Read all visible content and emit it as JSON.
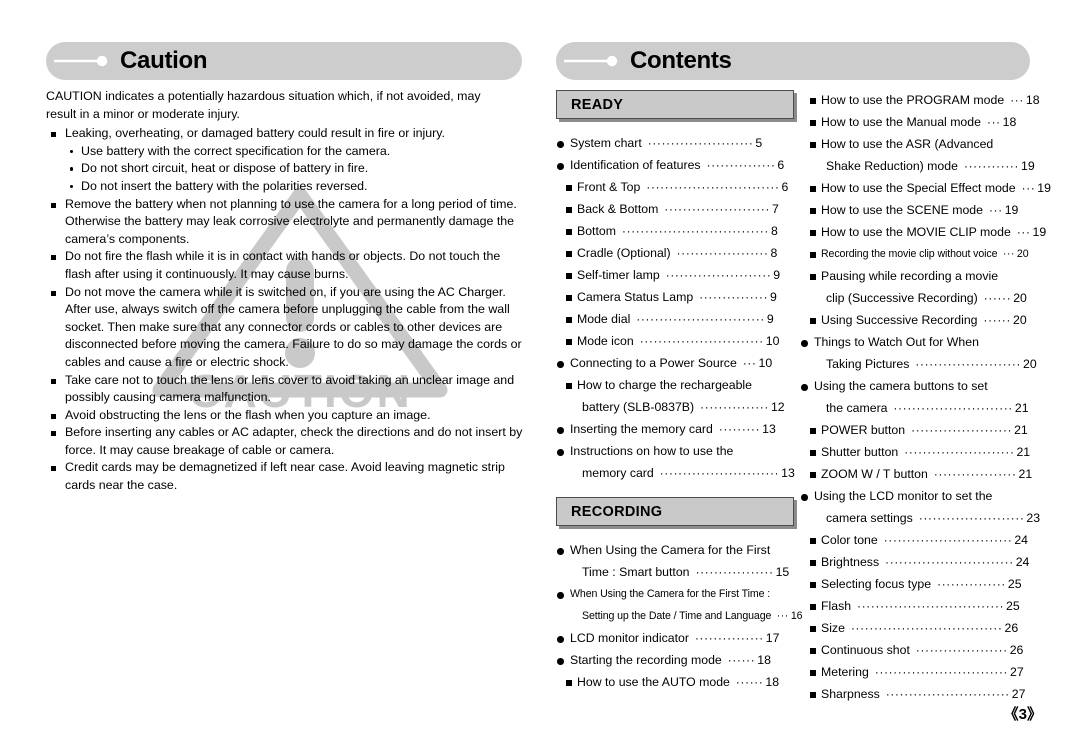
{
  "page": {
    "number_label": "《3》"
  },
  "caution": {
    "header_title": "Caution",
    "header_icon": "line-dot-icon",
    "intro": "CAUTION indicates a potentially hazardous situation which, if not avoided, may result in a minor or moderate injury.",
    "items": [
      {
        "text": "Leaking, overheating, or damaged battery could result in fire or injury.",
        "subitems": [
          "Use battery with the correct specification for the camera.",
          "Do not short circuit, heat or dispose of battery in fire.",
          "Do not insert the battery with the polarities reversed."
        ]
      },
      {
        "text": "Remove the battery when not planning to use the camera for a long period of time. Otherwise the battery may leak corrosive electrolyte and permanently damage the camera’s components.",
        "subitems": []
      },
      {
        "text": "Do not fire the flash while it is in contact with hands or objects. Do not touch the flash after using it continuously. It may cause burns.",
        "subitems": []
      },
      {
        "text": "Do not move the camera while it is switched on, if you are using the AC Charger. After use, always switch off the camera before unplugging the cable from the wall socket. Then make sure that any connector cords or cables to other devices are disconnected before moving the camera. Failure to do so may damage the cords or cables and cause a fire or electric shock.",
        "subitems": []
      },
      {
        "text": "Take care not to touch the lens or lens cover to avoid taking an unclear image and possibly causing camera malfunction.",
        "subitems": []
      },
      {
        "text": "Avoid obstructing the lens or the flash when you capture an image.",
        "subitems": []
      },
      {
        "text": "Before inserting any cables or AC adapter, check the directions and do not insert by force. It may cause breakage of cable or camera.",
        "subitems": []
      },
      {
        "text": "Credit cards may be demagnetized if left near case. Avoid leaving magnetic strip cards near the case.",
        "subitems": []
      }
    ],
    "watermark": {
      "shape": "warning-triangle-icon",
      "text": "CAUTION",
      "color": "#c9c9c9"
    }
  },
  "contents": {
    "header_title": "Contents",
    "header_icon": "line-dot-icon",
    "sections": [
      {
        "id": "ready",
        "label": "READY"
      },
      {
        "id": "recording",
        "label": "RECORDING"
      }
    ],
    "column_mid_top": [
      {
        "level": 1,
        "label": "System chart",
        "dots": "·······················",
        "page": "5"
      },
      {
        "level": 1,
        "label": "Identification of features",
        "dots": "···············",
        "page": "6"
      },
      {
        "level": 2,
        "label": "Front & Top",
        "dots": "·····························",
        "page": "6"
      },
      {
        "level": 2,
        "label": "Back & Bottom",
        "dots": "·······················",
        "page": "7"
      },
      {
        "level": 2,
        "label": "Bottom",
        "dots": "································",
        "page": "8"
      },
      {
        "level": 2,
        "label": "Cradle (Optional)",
        "dots": "····················",
        "page": "8"
      },
      {
        "level": 2,
        "label": "Self-timer lamp",
        "dots": "·······················",
        "page": "9"
      },
      {
        "level": 2,
        "label": "Camera Status Lamp",
        "dots": "···············",
        "page": "9"
      },
      {
        "level": 2,
        "label": "Mode dial",
        "dots": "····························",
        "page": "9"
      },
      {
        "level": 2,
        "label": "Mode icon",
        "dots": "···························",
        "page": "10"
      },
      {
        "level": 1,
        "label": "Connecting to a Power Source",
        "dots": "···",
        "page": "10"
      },
      {
        "level": 2,
        "label": "How to charge the rechargeable",
        "dots": "",
        "page": ""
      },
      {
        "level": 0,
        "label": "battery (SLB-0837B)",
        "dots": "···············",
        "page": "12"
      },
      {
        "level": 1,
        "label": "Inserting the memory card",
        "dots": "·········",
        "page": "13"
      },
      {
        "level": 1,
        "label": "Instructions on how to use the",
        "dots": "",
        "page": ""
      },
      {
        "level": 0,
        "label": "memory card",
        "dots": "··························",
        "page": "13"
      }
    ],
    "column_mid_bottom": [
      {
        "level": 1,
        "label": "When Using the Camera for the First",
        "dots": "",
        "page": ""
      },
      {
        "level": 0,
        "label": "Time : Smart button",
        "dots": "·················",
        "page": "15"
      },
      {
        "level": 1,
        "small": true,
        "label": "When Using the Camera for the First Time :",
        "dots": "",
        "page": ""
      },
      {
        "level": 0,
        "small": true,
        "label": "Setting up the Date / Time and Language",
        "dots": "···",
        "page": "16"
      },
      {
        "level": 1,
        "label": "LCD monitor indicator",
        "dots": "···············",
        "page": "17"
      },
      {
        "level": 1,
        "label": "Starting the recording mode",
        "dots": "······",
        "page": "18"
      },
      {
        "level": 2,
        "label": "How to use the AUTO mode",
        "dots": "······",
        "page": "18"
      }
    ],
    "column_right": [
      {
        "level": 2,
        "label": "How to use the PROGRAM mode",
        "dots": "···",
        "page": "18"
      },
      {
        "level": 2,
        "label": "How to use the Manual mode",
        "dots": "···",
        "page": "18"
      },
      {
        "level": 2,
        "label": "How to use the ASR (Advanced",
        "dots": "",
        "page": ""
      },
      {
        "level": 0,
        "label": "Shake Reduction) mode",
        "dots": "············",
        "page": "19"
      },
      {
        "level": 2,
        "label": "How to use the Special Effect mode",
        "dots": "···",
        "page": "19"
      },
      {
        "level": 2,
        "label": "How to use the SCENE mode",
        "dots": "···",
        "page": "19"
      },
      {
        "level": 2,
        "label": "How to use the MOVIE CLIP mode",
        "dots": "···",
        "page": "19"
      },
      {
        "level": 2,
        "small": true,
        "label": "Recording the movie clip without voice",
        "dots": "···",
        "page": "20"
      },
      {
        "level": 2,
        "label": "Pausing while recording a movie",
        "dots": "",
        "page": ""
      },
      {
        "level": 0,
        "label": "clip (Successive Recording)",
        "dots": "······",
        "page": "20"
      },
      {
        "level": 2,
        "label": "Using Successive Recording",
        "dots": "······",
        "page": "20"
      },
      {
        "level": 1,
        "label": "Things to Watch Out for When",
        "dots": "",
        "page": ""
      },
      {
        "level": 0,
        "label": "Taking Pictures",
        "dots": "·······················",
        "page": "20"
      },
      {
        "level": 1,
        "label": "Using the camera buttons to set",
        "dots": "",
        "page": ""
      },
      {
        "level": 0,
        "label": "the camera",
        "dots": "··························",
        "page": "21"
      },
      {
        "level": 2,
        "label": "POWER button",
        "dots": "······················",
        "page": "21"
      },
      {
        "level": 2,
        "label": "Shutter button",
        "dots": "························",
        "page": "21"
      },
      {
        "level": 2,
        "label": "ZOOM W / T button",
        "dots": "··················",
        "page": "21"
      },
      {
        "level": 1,
        "label": "Using the LCD monitor to set the",
        "dots": "",
        "page": ""
      },
      {
        "level": 0,
        "label": "camera settings",
        "dots": "·······················",
        "page": "23"
      },
      {
        "level": 2,
        "label": "Color tone",
        "dots": "····························",
        "page": "24"
      },
      {
        "level": 2,
        "label": "Brightness",
        "dots": "····························",
        "page": "24"
      },
      {
        "level": 2,
        "label": "Selecting focus type",
        "dots": "···············",
        "page": "25"
      },
      {
        "level": 2,
        "label": "Flash",
        "dots": "································",
        "page": "25"
      },
      {
        "level": 2,
        "label": "Size",
        "dots": "·································",
        "page": "26"
      },
      {
        "level": 2,
        "label": "Continuous shot",
        "dots": "····················",
        "page": "26"
      },
      {
        "level": 2,
        "label": "Metering",
        "dots": "·····························",
        "page": "27"
      },
      {
        "level": 2,
        "label": "Sharpness",
        "dots": "···························",
        "page": "27"
      }
    ]
  }
}
